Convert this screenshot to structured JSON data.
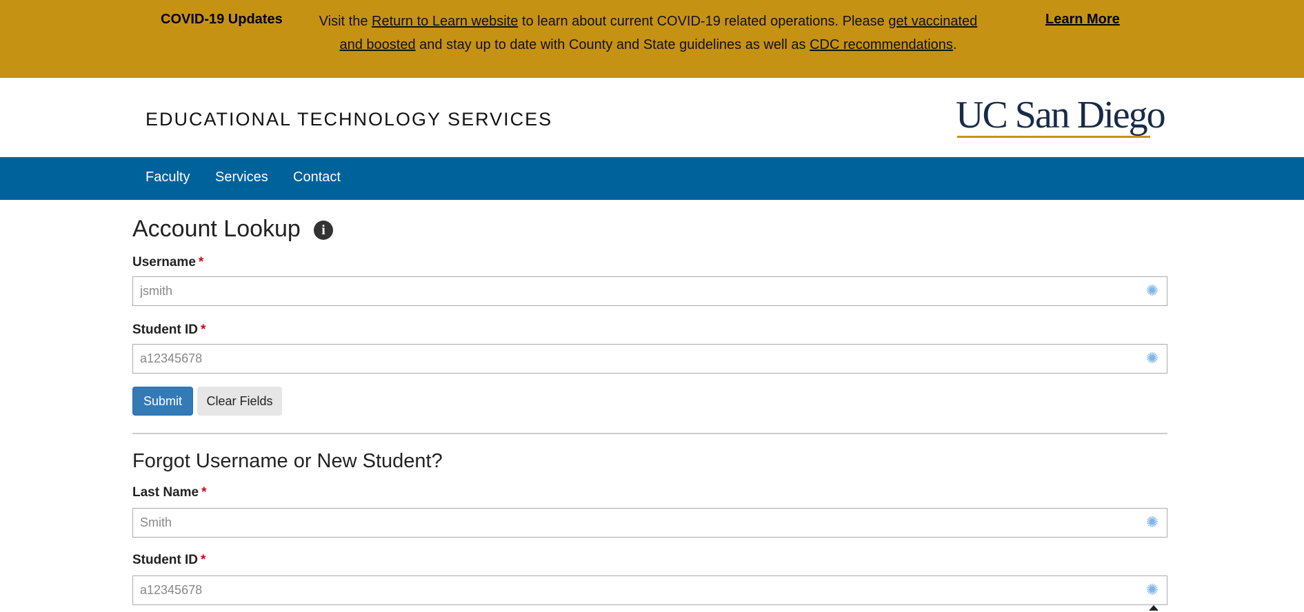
{
  "banner": {
    "title": "COVID-19 Updates",
    "text_pre": "Visit the ",
    "link_return": "Return to Learn website",
    "text_mid": " to learn about current COVID-19 related operations. Please ",
    "link_vaccinated": "get vaccinated and boosted",
    "text_mid2": " and stay up to date with County and State guidelines as well as ",
    "link_cdc": "CDC recommendations",
    "text_end": ".",
    "learn_more": "Learn More"
  },
  "header": {
    "site_name": "EDUCATIONAL TECHNOLOGY SERVICES",
    "logo_text": "UC San Diego"
  },
  "nav": {
    "items": [
      {
        "label": "Faculty"
      },
      {
        "label": "Services"
      },
      {
        "label": "Contact"
      }
    ]
  },
  "lookup": {
    "title": "Account Lookup",
    "username_label": "Username",
    "username_placeholder": "jsmith",
    "studentid_label": "Student ID",
    "studentid_placeholder": "a12345678",
    "submit": "Submit",
    "clear": "Clear Fields"
  },
  "forgot": {
    "title": "Forgot Username or New Student?",
    "lastname_label": "Last Name",
    "lastname_placeholder": "Smith",
    "studentid_label": "Student ID",
    "studentid_placeholder": "a12345678"
  },
  "required_marker": "*",
  "colors": {
    "banner": "#c69214",
    "nav": "#00629b",
    "primary_button": "#337ab7",
    "required": "#d9001b",
    "logo_navy": "#182b49"
  },
  "icons": {
    "info": "info-circle-icon",
    "field_helper": "asterisk-icon"
  }
}
